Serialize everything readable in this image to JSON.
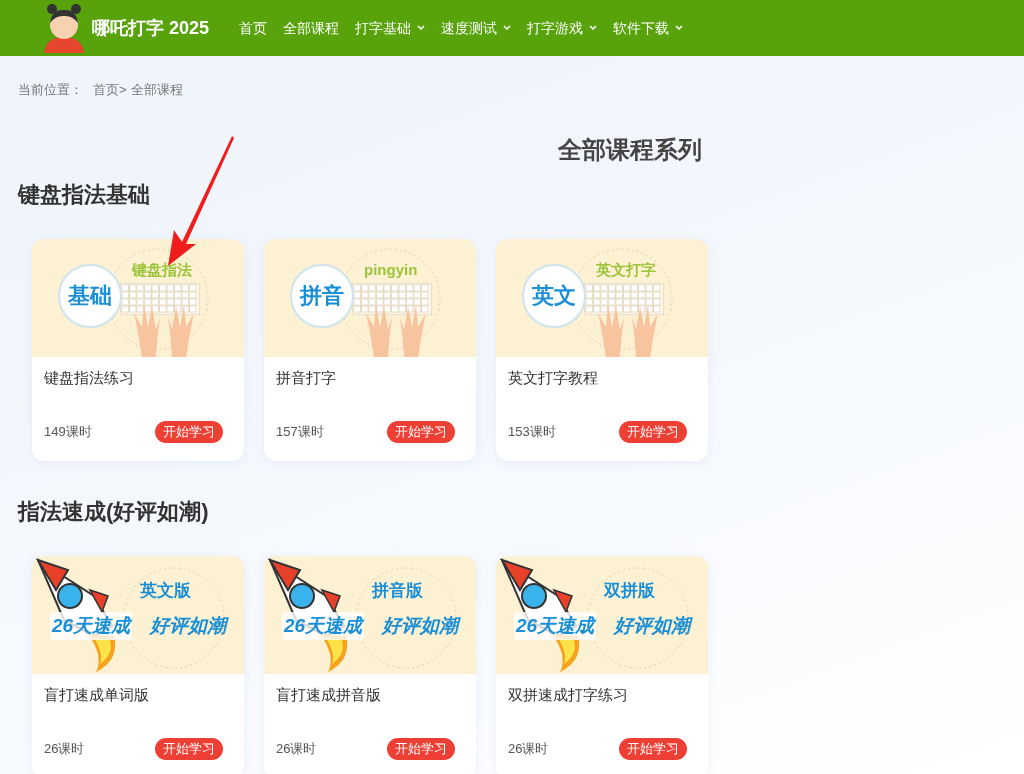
{
  "header": {
    "site_title": "哪吒打字 2025",
    "nav": [
      {
        "label": "首页",
        "dropdown": false
      },
      {
        "label": "全部课程",
        "dropdown": false
      },
      {
        "label": "打字基础",
        "dropdown": true
      },
      {
        "label": "速度测试",
        "dropdown": true
      },
      {
        "label": "打字游戏",
        "dropdown": true
      },
      {
        "label": "软件下载",
        "dropdown": true
      }
    ]
  },
  "breadcrumb": {
    "label": "当前位置：",
    "items": [
      "首页>",
      "全部课程"
    ]
  },
  "page_title": "全部课程系列",
  "sections": [
    {
      "heading": "键盘指法基础",
      "courses": [
        {
          "thumbnail": {
            "kind": "keyboard",
            "badge": "基础",
            "caption": "键盘指法"
          },
          "title": "键盘指法练习",
          "lessons": "149课时",
          "button": "开始学习"
        },
        {
          "thumbnail": {
            "kind": "keyboard",
            "badge": "拼音",
            "caption": "pingyin"
          },
          "title": "拼音打字",
          "lessons": "157课时",
          "button": "开始学习"
        },
        {
          "thumbnail": {
            "kind": "keyboard",
            "badge": "英文",
            "caption": "英文打字"
          },
          "title": "英文打字教程",
          "lessons": "153课时",
          "button": "开始学习"
        }
      ]
    },
    {
      "heading": "指法速成(好评如潮)",
      "courses": [
        {
          "thumbnail": {
            "kind": "rocket",
            "caption": "英文版",
            "slogan": [
              "26天速成",
              "好评如潮"
            ]
          },
          "title": "盲打速成单词版",
          "lessons": "26课时",
          "button": "开始学习"
        },
        {
          "thumbnail": {
            "kind": "rocket",
            "caption": "拼音版",
            "slogan": [
              "26天速成",
              "好评如潮"
            ]
          },
          "title": "盲打速成拼音版",
          "lessons": "26课时",
          "button": "开始学习"
        },
        {
          "thumbnail": {
            "kind": "rocket",
            "caption": "双拼版",
            "slogan": [
              "26天速成",
              "好评如潮"
            ]
          },
          "title": "双拼速成打字练习",
          "lessons": "26课时",
          "button": "开始学习"
        }
      ]
    }
  ]
}
